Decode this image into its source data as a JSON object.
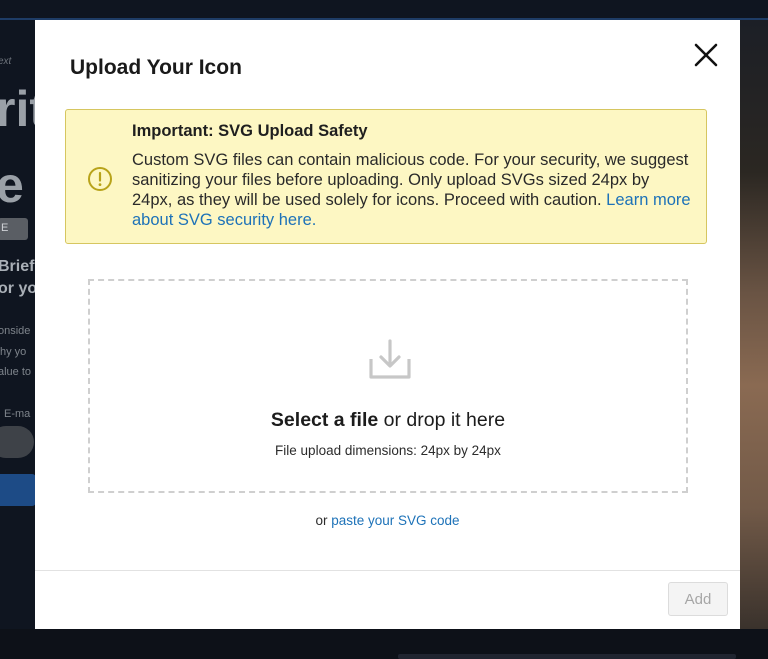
{
  "background": {
    "fragments": [
      "ext",
      "rit",
      "e",
      "E",
      "Briefl",
      "or yo",
      "onside",
      "hy yo",
      "alue to",
      "E-ma"
    ]
  },
  "modal": {
    "title": "Upload Your Icon",
    "close_icon": "close-icon"
  },
  "alert": {
    "icon": "exclamation-circle-icon",
    "title": "Important: SVG Upload Safety",
    "body": "Custom SVG files can contain malicious code. For your security, we suggest sanitizing your files before uploading. Only upload SVGs sized 24px by 24px, as they will be used solely for icons. Proceed with caution. ",
    "link": "Learn more about SVG security here.",
    "colors": {
      "background": "#fdf7c3",
      "border": "#d6c660",
      "icon": "#b8a31a"
    }
  },
  "dropzone": {
    "icon": "download-tray-icon",
    "select_label": "Select a file",
    "drop_text": " or drop it here",
    "dimensions": "File upload dimensions: 24px by 24px"
  },
  "paste": {
    "prefix": "or ",
    "link": "paste your SVG code"
  },
  "footer": {
    "add_label": "Add",
    "add_disabled": true
  },
  "colors": {
    "link": "#1d72b8",
    "overlay": "#0c1017"
  }
}
